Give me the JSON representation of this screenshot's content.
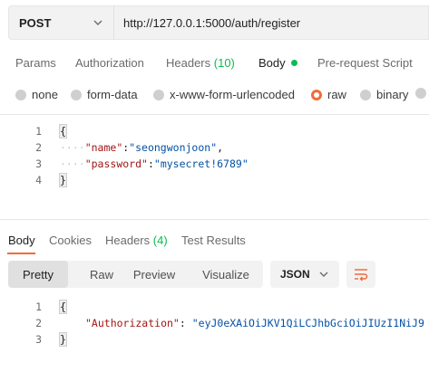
{
  "request": {
    "method": "POST",
    "url": "http://127.0.0.1:5000/auth/register"
  },
  "request_tabs": [
    {
      "label": "Params"
    },
    {
      "label": "Authorization"
    },
    {
      "label": "Headers",
      "count": "(10)"
    },
    {
      "label": "Body",
      "active": true
    },
    {
      "label": "Pre-request Script"
    }
  ],
  "body_types": [
    {
      "label": "none"
    },
    {
      "label": "form-data"
    },
    {
      "label": "x-www-form-urlencoded"
    },
    {
      "label": "raw",
      "selected": true
    },
    {
      "label": "binary"
    }
  ],
  "request_body": {
    "lines": [
      {
        "num": "1",
        "open": "{"
      },
      {
        "num": "2",
        "key": "\"name\"",
        "colon": ":",
        "value": "\"seongwonjoon\"",
        "tail": ","
      },
      {
        "num": "3",
        "key": "\"password\"",
        "colon": ":",
        "value": "\"mysecret!6789\"",
        "tail": ""
      },
      {
        "num": "4",
        "close": "}"
      }
    ]
  },
  "response_tabs": [
    {
      "label": "Body",
      "active": true
    },
    {
      "label": "Cookies"
    },
    {
      "label": "Headers",
      "count": "(4)"
    },
    {
      "label": "Test Results"
    }
  ],
  "view_modes": [
    {
      "label": "Pretty",
      "active": true
    },
    {
      "label": "Raw"
    },
    {
      "label": "Preview"
    },
    {
      "label": "Visualize"
    }
  ],
  "format": "JSON",
  "response_body": {
    "lines": [
      {
        "num": "1",
        "open": "{"
      },
      {
        "num": "2",
        "key": "\"Authorization\"",
        "colon": ": ",
        "value": "\"eyJ0eXAiOiJKV1QiLCJhbGciOiJIUzI1NiJ9"
      },
      {
        "num": "3",
        "close": "}"
      }
    ]
  },
  "colors": {
    "accent": "#f26b3a",
    "success": "#0cbb52",
    "json_key": "#a31515",
    "json_string": "#0451a5"
  },
  "icons": {
    "method_dropdown": "chevron-down-icon",
    "format_dropdown": "chevron-down-icon",
    "wrap": "wrap-lines-icon",
    "active_body_indicator": "green-dot-icon"
  }
}
